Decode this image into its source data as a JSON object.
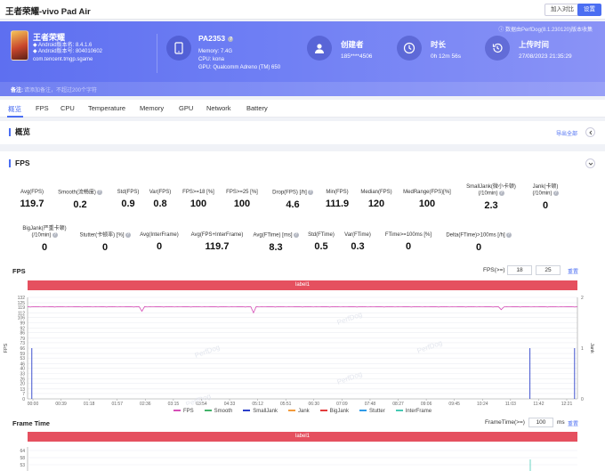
{
  "window": {
    "title": "王者荣耀-vivo Pad Air",
    "join_btn": "加入对比",
    "settings_btn": "设置"
  },
  "banner": {
    "perf_note": "数据由PerfDog(8.1.230120)版本收集",
    "app_name": "王者荣耀",
    "android_version": "Android版本名: 8.4.1.6",
    "android_code": "Android版本号: 804010602",
    "package": "com.tencent.tmgp.sgame",
    "device_name": "PA2353",
    "memory": "Memory: 7.4G",
    "cpu": "CPU: kona",
    "gpu": "GPU: Qualcomm Adreno (TM) 650",
    "creator_label": "创建者",
    "creator_value": "185****4506",
    "duration_label": "时长",
    "duration_value": "0h 12m 56s",
    "upload_label": "上传时间",
    "upload_value": "27/08/2023 21:35:29",
    "remark_label": "备注:",
    "remark_placeholder": "请添加备注，不超过200个字符"
  },
  "tabs": [
    "概览",
    "FPS",
    "CPU",
    "Temperature",
    "Memory",
    "GPU",
    "Network",
    "Battery"
  ],
  "overview": {
    "title": "概览",
    "export_link": "导出全部"
  },
  "fps_section": {
    "title": "FPS",
    "row1": [
      {
        "label": "Avg(FPS)",
        "value": "119.7"
      },
      {
        "label": "Smooth(流畅度)",
        "value": "0.2",
        "help": true
      },
      {
        "label": "Std(FPS)",
        "value": "0.9"
      },
      {
        "label": "Var(FPS)",
        "value": "0.8"
      },
      {
        "label": "FPS>=18 [%]",
        "value": "100"
      },
      {
        "label": "FPS>=25 [%]",
        "value": "100"
      },
      {
        "label": "Drop(FPS) [/h]",
        "value": "4.6",
        "help": true
      },
      {
        "label": "Min(FPS)",
        "value": "111.9"
      },
      {
        "label": "Median(FPS)",
        "value": "120"
      },
      {
        "label": "MedRange(FPS)[%]",
        "value": "100"
      },
      {
        "label": "SmallJank(微小卡顿)",
        "label2": "(/10min)",
        "value": "2.3",
        "help": true
      },
      {
        "label": "Jank(卡顿)",
        "label2": "(/10min)",
        "value": "0",
        "help": true
      }
    ],
    "row2": [
      {
        "label": "BigJank(严重卡顿)",
        "label2": "(/10min)",
        "value": "0",
        "help": true
      },
      {
        "label": "Stutter(卡顿率) [%]",
        "value": "0",
        "help": true
      },
      {
        "label": "Avg(InterFrame)",
        "value": "0"
      },
      {
        "label": "Avg(FPS+InterFrame)",
        "value": "119.7"
      },
      {
        "label": "Avg(FTime) [ms]",
        "value": "8.3",
        "help": true
      },
      {
        "label": "Std(FTime)",
        "value": "0.5"
      },
      {
        "label": "Var(FTime)",
        "value": "0.3"
      },
      {
        "label": "FTime>=100ms [%]",
        "value": "0"
      },
      {
        "label": "Delta(FTime)>100ms [/h]",
        "value": "0",
        "help": true
      }
    ]
  },
  "fps_chart": {
    "title": "FPS",
    "filter_label": "FPS(>=)",
    "filter_v1": "18",
    "filter_v2": "25",
    "reset": "重置",
    "label_bar": "label1",
    "watermark": "PerfDog"
  },
  "chart_data": {
    "type": "line",
    "ylabel": "FPS",
    "y2label": "Jank",
    "yticks": [
      0,
      7,
      13,
      20,
      26,
      33,
      40,
      46,
      53,
      59,
      66,
      73,
      79,
      86,
      92,
      99,
      106,
      112,
      119,
      125,
      132
    ],
    "ylim": [
      0,
      132
    ],
    "y2ticks": [
      0,
      1,
      2
    ],
    "y2lim": [
      0,
      2
    ],
    "xticks": [
      "00:00",
      "00:39",
      "01:18",
      "01:57",
      "02:36",
      "03:15",
      "03:54",
      "04:33",
      "05:12",
      "05:51",
      "06:30",
      "07:09",
      "07:48",
      "08:27",
      "09:06",
      "09:45",
      "10:24",
      "11:03",
      "11:42",
      "12:21"
    ],
    "legend": [
      "FPS",
      "Smooth",
      "SmallJank",
      "Jank",
      "BigJank",
      "Stutter",
      "InterFrame"
    ],
    "series": [
      {
        "name": "FPS",
        "color": "#d64fb7",
        "values": [
          120,
          119.5,
          120,
          119.8,
          120,
          119.6,
          120,
          119.7,
          120,
          119.9,
          119.5,
          120,
          119.8,
          120,
          119.6,
          120,
          119.7,
          120,
          119.9,
          120,
          119.5,
          120,
          119.8,
          120,
          119.6,
          120,
          119.7,
          119.9,
          120,
          119.5,
          120,
          119.8,
          120,
          119.6,
          120,
          119.7,
          120,
          119.9,
          120,
          119.5,
          120,
          119.8,
          114,
          120,
          119.6,
          120,
          119.7,
          120,
          119.9,
          120,
          119.5,
          120,
          119.8,
          120,
          119.6,
          120,
          119.7,
          120,
          119.9,
          120,
          119.5,
          120,
          119.8,
          120,
          119.6,
          120,
          119.7,
          120,
          119.9,
          120,
          119.5,
          120,
          119.8,
          120,
          119.6,
          120,
          119.7,
          120,
          119.9,
          120,
          119.5,
          120,
          119.8,
          112,
          120,
          119.6,
          120,
          119.7,
          120,
          119.9,
          120,
          119.5,
          120,
          119.8,
          120,
          119.6,
          120,
          119.7,
          120,
          119.9,
          120,
          119.5,
          120,
          119.8,
          120,
          119.6,
          120,
          119.7,
          120,
          119.9,
          120,
          119.5,
          120,
          119.8,
          120,
          119.6,
          120,
          119.7,
          120,
          119.9,
          120,
          119.5,
          120,
          119.8,
          120,
          119.6,
          120,
          119.7,
          120,
          119.9,
          120,
          119.5,
          120,
          119.8,
          120,
          119.6,
          120,
          119.7,
          120,
          119.9,
          120,
          119.5,
          120,
          119.8,
          120,
          119.6,
          120,
          119.7,
          120,
          119.9,
          120,
          119.5,
          120,
          119.8,
          120,
          119.6,
          120,
          119.7,
          120,
          119.9,
          120,
          119.5,
          120,
          119.8,
          120,
          119.6,
          120,
          119.7,
          120,
          119.9,
          120,
          119.5,
          120,
          119.8,
          116,
          119.6,
          120,
          119.7,
          120,
          119.9,
          120,
          119.5,
          120,
          119.8,
          120,
          119.6,
          120,
          119.7,
          120,
          119.9,
          120,
          119.5,
          120,
          119.8,
          120,
          119.6,
          120,
          119.7,
          120,
          119.9,
          120,
          119.5,
          120
        ]
      },
      {
        "name": "SmallJank",
        "color": "#2b3fc9",
        "spikes_at": [
          "00:06",
          "11:49",
          "12:52"
        ],
        "spike_value": 1
      }
    ]
  },
  "frametime_chart": {
    "title": "Frame Time",
    "filter_label": "FrameTime(>=)",
    "filter_value": "100",
    "unit": "ms",
    "reset": "重置",
    "label_bar": "label1",
    "yticks": [
      "64",
      "58",
      "53"
    ]
  }
}
